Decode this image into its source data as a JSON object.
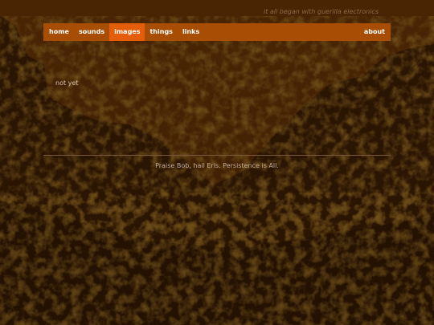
{
  "header": {
    "tagline": "it all began with guerilla electronics"
  },
  "nav": {
    "items": [
      {
        "label": "home"
      },
      {
        "label": "sounds"
      },
      {
        "label": "images",
        "active": true
      },
      {
        "label": "things"
      },
      {
        "label": "links"
      }
    ],
    "right_item": {
      "label": "about"
    }
  },
  "main": {
    "text": "not yet"
  },
  "footer": {
    "text": "Praise Bob, hail Eris. Persistence is All."
  },
  "colors": {
    "nav_bg": "#a84d04",
    "nav_active": "#e35d0a",
    "background": "#3c1f02"
  }
}
